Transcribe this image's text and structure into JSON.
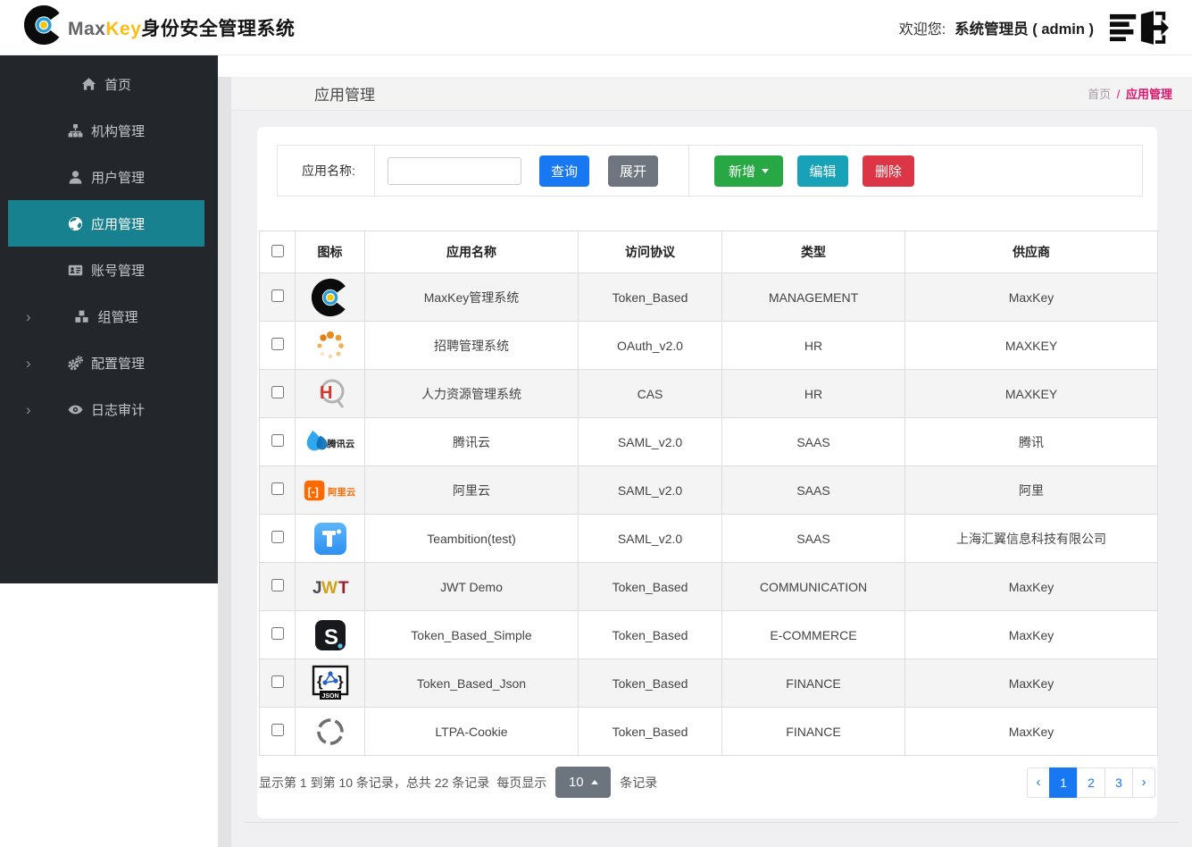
{
  "header": {
    "brand_max": "Max",
    "brand_key": "Key",
    "brand_suffix": "身份安全管理系统",
    "welcome_label": "欢迎您:",
    "username": "系统管理员 ( admin )"
  },
  "sidebar": {
    "items": [
      {
        "label": "首页",
        "icon": "home-icon",
        "active": false,
        "expandable": false
      },
      {
        "label": "机构管理",
        "icon": "sitemap-icon",
        "active": false,
        "expandable": false
      },
      {
        "label": "用户管理",
        "icon": "user-icon",
        "active": false,
        "expandable": false
      },
      {
        "label": "应用管理",
        "icon": "globe-icon",
        "active": true,
        "expandable": false
      },
      {
        "label": "账号管理",
        "icon": "id-card-icon",
        "active": false,
        "expandable": false
      },
      {
        "label": "组管理",
        "icon": "cubes-icon",
        "active": false,
        "expandable": true
      },
      {
        "label": "配置管理",
        "icon": "gears-icon",
        "active": false,
        "expandable": true
      },
      {
        "label": "日志审计",
        "icon": "eye-icon",
        "active": false,
        "expandable": true
      }
    ]
  },
  "page": {
    "title": "应用管理",
    "breadcrumb_home": "首页",
    "breadcrumb_sep": "/",
    "breadcrumb_current": "应用管理"
  },
  "toolbar": {
    "search_label": "应用名称:",
    "search_value": "",
    "query_label": "查询",
    "expand_label": "展开",
    "add_label": "新增",
    "edit_label": "编辑",
    "delete_label": "删除"
  },
  "table": {
    "headers": [
      "图标",
      "应用名称",
      "访问协议",
      "类型",
      "供应商"
    ],
    "rows": [
      {
        "icon": "maxkey-app-icon",
        "name": "MaxKey管理系统",
        "protocol": "Token_Based",
        "category": "MANAGEMENT",
        "vendor": "MaxKey"
      },
      {
        "icon": "recruit-app-icon",
        "name": "招聘管理系统",
        "protocol": "OAuth_v2.0",
        "category": "HR",
        "vendor": "MAXKEY"
      },
      {
        "icon": "hr-app-icon",
        "name": "人力资源管理系统",
        "protocol": "CAS",
        "category": "HR",
        "vendor": "MAXKEY"
      },
      {
        "icon": "tencent-cloud-icon",
        "name": "腾讯云",
        "protocol": "SAML_v2.0",
        "category": "SAAS",
        "vendor": "腾讯"
      },
      {
        "icon": "alibaba-cloud-icon",
        "name": "阿里云",
        "protocol": "SAML_v2.0",
        "category": "SAAS",
        "vendor": "阿里"
      },
      {
        "icon": "teambition-icon",
        "name": "Teambition(test)",
        "protocol": "SAML_v2.0",
        "category": "SAAS",
        "vendor": "上海汇翼信息科技有限公司"
      },
      {
        "icon": "jwt-app-icon",
        "name": "JWT Demo",
        "protocol": "Token_Based",
        "category": "COMMUNICATION",
        "vendor": "MaxKey"
      },
      {
        "icon": "s-app-icon",
        "name": "Token_Based_Simple",
        "protocol": "Token_Based",
        "category": "E-COMMERCE",
        "vendor": "MaxKey"
      },
      {
        "icon": "json-app-icon",
        "name": "Token_Based_Json",
        "protocol": "Token_Based",
        "category": "FINANCE",
        "vendor": "MaxKey"
      },
      {
        "icon": "ltpa-app-icon",
        "name": "LTPA-Cookie",
        "protocol": "Token_Based",
        "category": "FINANCE",
        "vendor": "MaxKey"
      }
    ]
  },
  "pagination": {
    "info_text": "显示第 1 到第 10 条记录，总共 22 条记录",
    "per_page_label": "每页显示",
    "page_size": "10",
    "info_suffix": "条记录",
    "prev": "‹",
    "next": "›",
    "pages": [
      "1",
      "2",
      "3"
    ],
    "active_page": "1"
  },
  "colors": {
    "primary_blue": "#1778f2",
    "button_green": "#28a745",
    "button_teal": "#17a2b8",
    "button_red": "#dc3545",
    "sidebar_active_teal": "#17818f",
    "breadcrumb_pink": "#e0156d",
    "pagesize_gray": "#6c757d"
  }
}
